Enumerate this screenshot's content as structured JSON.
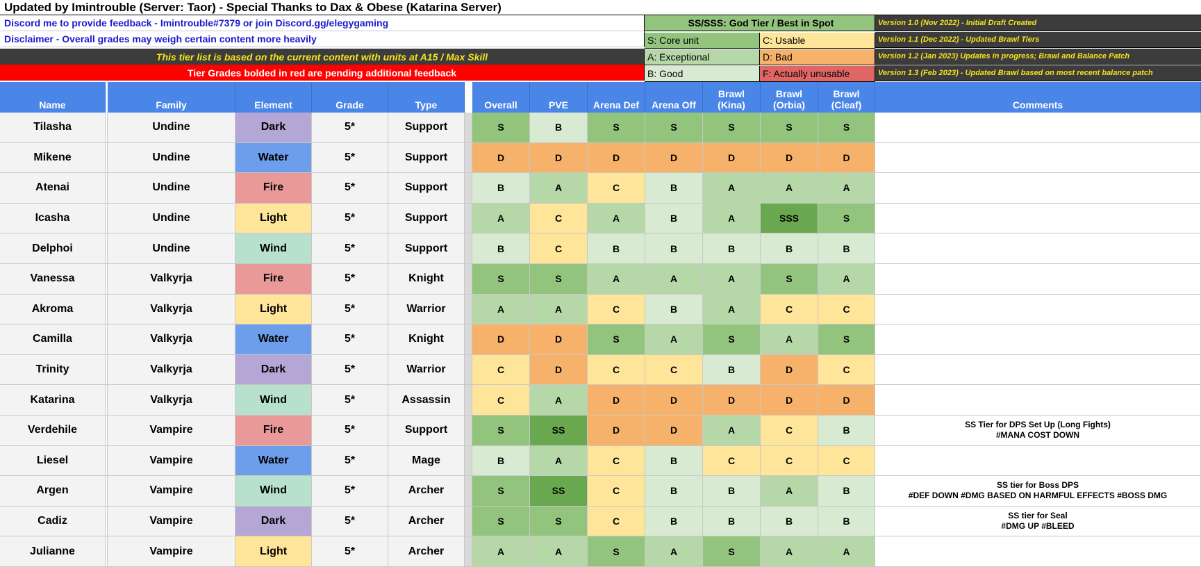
{
  "header": {
    "title": "Updated by Imintrouble (Server: Taor) - Special Thanks to Dax & Obese (Katarina Server)",
    "discord": "Discord me to provide feedback - Imintrouble#7379 or join Discord.gg/elegygaming",
    "disclaimer": "Disclaimer - Overall grades may weigh certain content more heavily",
    "basis": "This tier list is based on the current content with units at A15 / Max Skill",
    "pending": "Tier Grades bolded in red are pending additional feedback"
  },
  "legend": {
    "ss": "SS/SSS: God Tier / Best in Spot",
    "s": "S: Core unit",
    "c": "C: Usable",
    "a": "A: Exceptional",
    "d": "D: Bad",
    "b": "B: Good",
    "f": "F: Actually unusable"
  },
  "versions": [
    "Version 1.0 (Nov 2022) - Initial Draft Created",
    "Version 1.1 (Dec 2022) - Updated Brawl Tiers",
    "Version 1.2 (Jan 2023) Updates in progress; Brawl and Balance Patch",
    "Version 1.3 (Feb 2023) - Updated Brawl based on most recent balance patch"
  ],
  "columns": {
    "name": "Name",
    "family": "Family",
    "element": "Element",
    "grade": "Grade",
    "type": "Type",
    "overall": "Overall",
    "pve": "PVE",
    "arena_def": "Arena Def",
    "arena_off": "Arena Off",
    "brawl_kina": "Brawl\n(Kina)",
    "brawl_orbia": "Brawl\n(Orbia)",
    "brawl_cleaf": "Brawl\n(Cleaf)",
    "comments": "Comments"
  },
  "colors": {
    "tier": {
      "SSS": "#6aa84f",
      "SS": "#6aa84f",
      "S": "#93c47d",
      "A": "#b6d7a8",
      "B": "#d9ead3",
      "C": "#ffe599",
      "D": "#f6b26b",
      "F": "#e06666"
    },
    "element": {
      "Dark": "#b4a7d6",
      "Water": "#6d9eeb",
      "Fire": "#ea9999",
      "Light": "#ffe599",
      "Wind": "#b7e1cd"
    },
    "header_blue": "#4a86e8",
    "banner_dark": "#3c3c3c",
    "banner_text": "#f5e31d",
    "alert_red": "#ff0000"
  },
  "units": [
    {
      "name": "Tilasha",
      "family": "Undine",
      "element": "Dark",
      "grade": "5*",
      "type": "Support",
      "tiers": [
        "S",
        "B",
        "S",
        "S",
        "S",
        "S",
        "S"
      ],
      "comment": ""
    },
    {
      "name": "Mikene",
      "family": "Undine",
      "element": "Water",
      "grade": "5*",
      "type": "Support",
      "tiers": [
        "D",
        "D",
        "D",
        "D",
        "D",
        "D",
        "D"
      ],
      "comment": ""
    },
    {
      "name": "Atenai",
      "family": "Undine",
      "element": "Fire",
      "grade": "5*",
      "type": "Support",
      "tiers": [
        "B",
        "A",
        "C",
        "B",
        "A",
        "A",
        "A"
      ],
      "comment": ""
    },
    {
      "name": "Icasha",
      "family": "Undine",
      "element": "Light",
      "grade": "5*",
      "type": "Support",
      "tiers": [
        "A",
        "C",
        "A",
        "B",
        "A",
        "SSS",
        "S"
      ],
      "comment": ""
    },
    {
      "name": "Delphoi",
      "family": "Undine",
      "element": "Wind",
      "grade": "5*",
      "type": "Support",
      "tiers": [
        "B",
        "C",
        "B",
        "B",
        "B",
        "B",
        "B"
      ],
      "comment": ""
    },
    {
      "name": "Vanessa",
      "family": "Valkyrja",
      "element": "Fire",
      "grade": "5*",
      "type": "Knight",
      "tiers": [
        "S",
        "S",
        "A",
        "A",
        "A",
        "S",
        "A"
      ],
      "comment": ""
    },
    {
      "name": "Akroma",
      "family": "Valkyrja",
      "element": "Light",
      "grade": "5*",
      "type": "Warrior",
      "tiers": [
        "A",
        "A",
        "C",
        "B",
        "A",
        "C",
        "C"
      ],
      "comment": ""
    },
    {
      "name": "Camilla",
      "family": "Valkyrja",
      "element": "Water",
      "grade": "5*",
      "type": "Knight",
      "tiers": [
        "D",
        "D",
        "S",
        "A",
        "S",
        "A",
        "S"
      ],
      "comment": ""
    },
    {
      "name": "Trinity",
      "family": "Valkyrja",
      "element": "Dark",
      "grade": "5*",
      "type": "Warrior",
      "tiers": [
        "C",
        "D",
        "C",
        "C",
        "B",
        "D",
        "C"
      ],
      "comment": ""
    },
    {
      "name": "Katarina",
      "family": "Valkyrja",
      "element": "Wind",
      "grade": "5*",
      "type": "Assassin",
      "tiers": [
        "C",
        "A",
        "D",
        "D",
        "D",
        "D",
        "D"
      ],
      "comment": ""
    },
    {
      "name": "Verdehile",
      "family": "Vampire",
      "element": "Fire",
      "grade": "5*",
      "type": "Support",
      "tiers": [
        "S",
        "SS",
        "D",
        "D",
        "A",
        "C",
        "B"
      ],
      "comment": "SS Tier for DPS Set Up (Long Fights)\n#MANA COST DOWN"
    },
    {
      "name": "Liesel",
      "family": "Vampire",
      "element": "Water",
      "grade": "5*",
      "type": "Mage",
      "tiers": [
        "B",
        "A",
        "C",
        "B",
        "C",
        "C",
        "C"
      ],
      "comment": ""
    },
    {
      "name": "Argen",
      "family": "Vampire",
      "element": "Wind",
      "grade": "5*",
      "type": "Archer",
      "tiers": [
        "S",
        "SS",
        "C",
        "B",
        "B",
        "A",
        "B"
      ],
      "comment": "SS tier for Boss DPS\n#DEF DOWN #DMG BASED ON HARMFUL EFFECTS #BOSS DMG"
    },
    {
      "name": "Cadiz",
      "family": "Vampire",
      "element": "Dark",
      "grade": "5*",
      "type": "Archer",
      "tiers": [
        "S",
        "S",
        "C",
        "B",
        "B",
        "B",
        "B"
      ],
      "comment": "SS tier for Seal\n#DMG UP #BLEED"
    },
    {
      "name": "Julianne",
      "family": "Vampire",
      "element": "Light",
      "grade": "5*",
      "type": "Archer",
      "tiers": [
        "A",
        "A",
        "S",
        "A",
        "S",
        "A",
        "A"
      ],
      "comment": ""
    }
  ]
}
